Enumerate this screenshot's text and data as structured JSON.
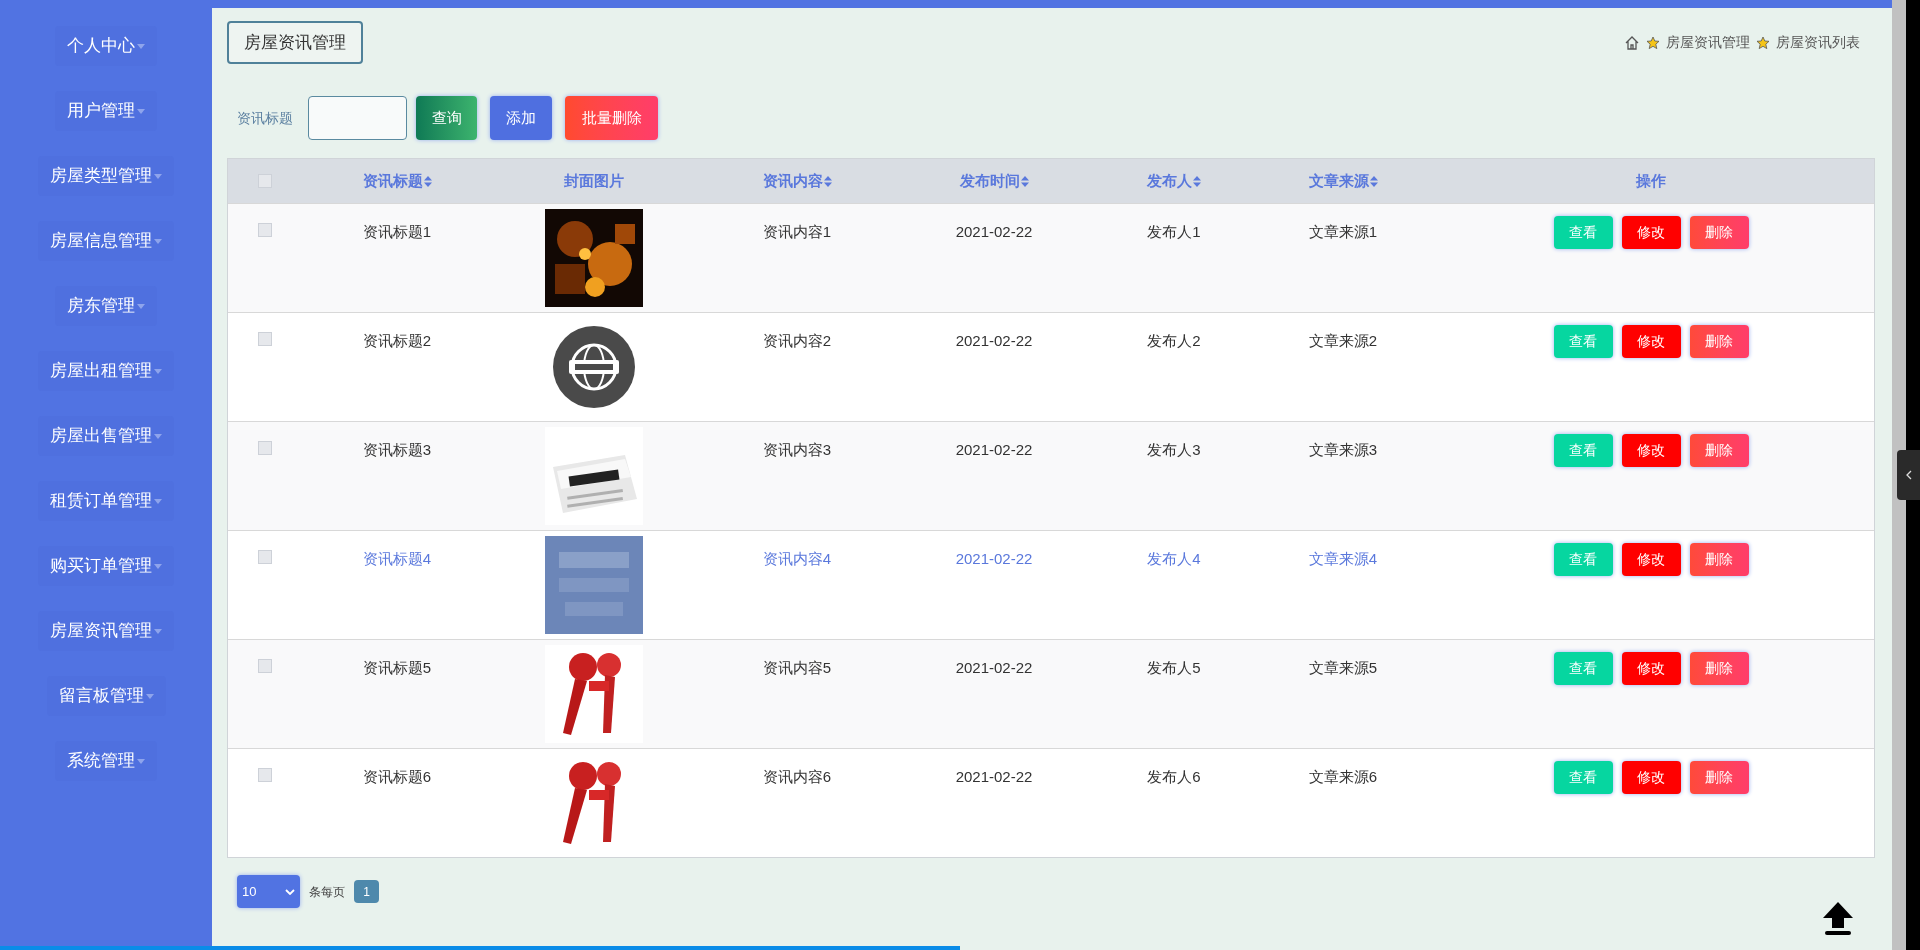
{
  "sidebar": {
    "items": [
      {
        "label": "个人中心"
      },
      {
        "label": "用户管理"
      },
      {
        "label": "房屋类型管理"
      },
      {
        "label": "房屋信息管理"
      },
      {
        "label": "房东管理"
      },
      {
        "label": "房屋出租管理"
      },
      {
        "label": "房屋出售管理"
      },
      {
        "label": "租赁订单管理"
      },
      {
        "label": "购买订单管理"
      },
      {
        "label": "房屋资讯管理"
      },
      {
        "label": "留言板管理"
      },
      {
        "label": "系统管理"
      }
    ]
  },
  "page_title": "房屋资讯管理",
  "breadcrumb": [
    "房屋资讯管理",
    "房屋资讯列表"
  ],
  "search": {
    "label": "资讯标题",
    "buttons": [
      {
        "label": "查询",
        "kind": "query"
      },
      {
        "label": "添加",
        "kind": "add"
      },
      {
        "label": "批量删除",
        "kind": "delete"
      }
    ]
  },
  "table": {
    "select_all": {
      "checked": false
    },
    "columns": [
      {
        "label": "资讯标题",
        "sortable": true
      },
      {
        "label": "封面图片",
        "sortable": false
      },
      {
        "label": "资讯内容",
        "sortable": true
      },
      {
        "label": "发布时间",
        "sortable": true
      },
      {
        "label": "发布人",
        "sortable": true
      },
      {
        "label": "文章来源",
        "sortable": true
      },
      {
        "label": "操作",
        "sortable": false
      }
    ],
    "rows": [
      {
        "title": "资讯标题1",
        "content": "资讯内容1",
        "time": "2021-02-22",
        "publisher": "发布人1",
        "source": "文章来源1",
        "hovered": false,
        "checked": false,
        "actions": [
          {
            "label": "查看",
            "kind": "view"
          },
          {
            "label": "修改",
            "kind": "edit"
          },
          {
            "label": "删除",
            "kind": "delete"
          }
        ]
      },
      {
        "title": "资讯标题2",
        "content": "资讯内容2",
        "time": "2021-02-22",
        "publisher": "发布人2",
        "source": "文章来源2",
        "hovered": false,
        "checked": false,
        "actions": [
          {
            "label": "查看",
            "kind": "view"
          },
          {
            "label": "修改",
            "kind": "edit"
          },
          {
            "label": "删除",
            "kind": "delete"
          }
        ]
      },
      {
        "title": "资讯标题3",
        "content": "资讯内容3",
        "time": "2021-02-22",
        "publisher": "发布人3",
        "source": "文章来源3",
        "hovered": false,
        "checked": false,
        "actions": [
          {
            "label": "查看",
            "kind": "view"
          },
          {
            "label": "修改",
            "kind": "edit"
          },
          {
            "label": "删除",
            "kind": "delete"
          }
        ]
      },
      {
        "title": "资讯标题4",
        "content": "资讯内容4",
        "time": "2021-02-22",
        "publisher": "发布人4",
        "source": "文章来源4",
        "hovered": true,
        "checked": false,
        "actions": [
          {
            "label": "查看",
            "kind": "view"
          },
          {
            "label": "修改",
            "kind": "edit"
          },
          {
            "label": "删除",
            "kind": "delete"
          }
        ]
      },
      {
        "title": "资讯标题5",
        "content": "资讯内容5",
        "time": "2021-02-22",
        "publisher": "发布人5",
        "source": "文章来源5",
        "hovered": false,
        "checked": false,
        "actions": [
          {
            "label": "查看",
            "kind": "view"
          },
          {
            "label": "修改",
            "kind": "edit"
          },
          {
            "label": "删除",
            "kind": "delete"
          }
        ]
      },
      {
        "title": "资讯标题6",
        "content": "资讯内容6",
        "time": "2021-02-22",
        "publisher": "发布人6",
        "source": "文章来源6",
        "hovered": false,
        "checked": false,
        "actions": [
          {
            "label": "查看",
            "kind": "view"
          },
          {
            "label": "修改",
            "kind": "edit"
          },
          {
            "label": "删除",
            "kind": "delete"
          }
        ]
      }
    ]
  },
  "pagination": {
    "page_size": "10",
    "per_page_label": "条每页",
    "pages": [
      {
        "label": "1",
        "selected": true
      }
    ]
  },
  "video_seek": {
    "level": 0.5
  }
}
